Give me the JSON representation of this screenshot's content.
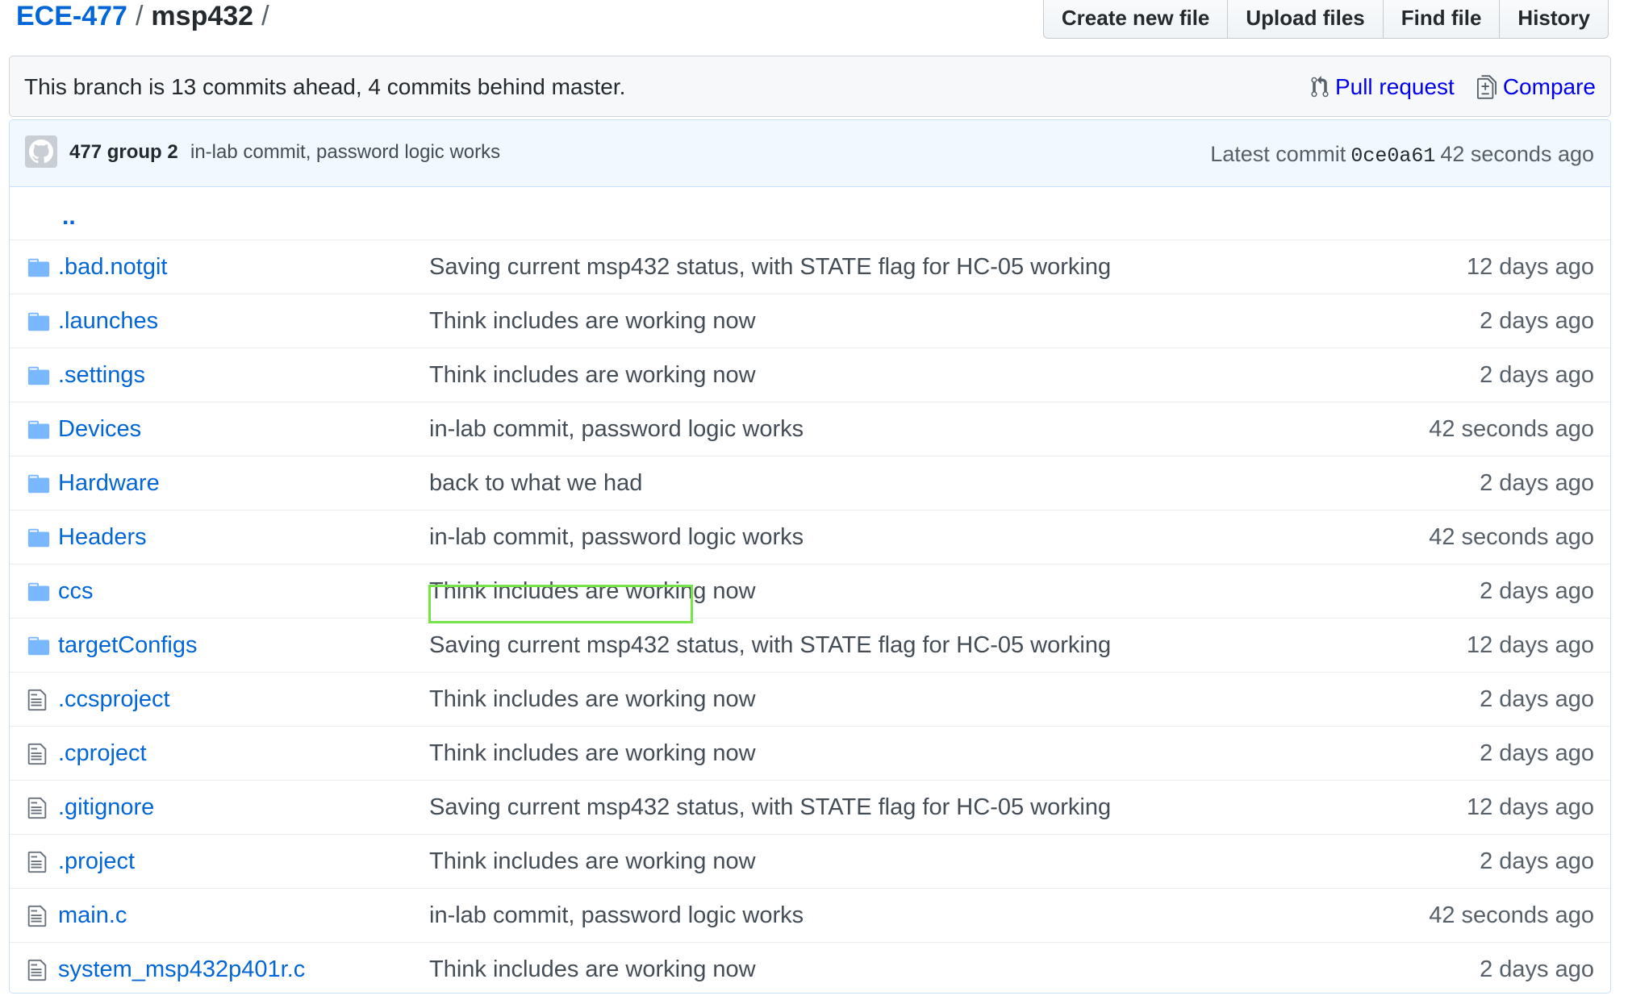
{
  "breadcrumb": {
    "repo": "ECE-477",
    "separator": "/",
    "directory": "msp432",
    "trailing": "/"
  },
  "toolbar": {
    "create_new_file": "Create new file",
    "upload_files": "Upload files",
    "find_file": "Find file",
    "history": "History"
  },
  "branch_info": {
    "message": "This branch is 13 commits ahead, 4 commits behind master.",
    "pull_request": "Pull request",
    "compare": "Compare"
  },
  "latest_commit": {
    "author": "477 group 2",
    "message": "in-lab commit, password logic works",
    "label": "Latest commit",
    "sha": "0ce0a61",
    "age": "42 seconds ago"
  },
  "parent_link": "..",
  "files": [
    {
      "type": "folder",
      "name": ".bad.notgit",
      "message": "Saving current msp432 status, with STATE flag for HC-05 working",
      "age": "12 days ago"
    },
    {
      "type": "folder",
      "name": ".launches",
      "message": "Think includes are working now",
      "age": "2 days ago"
    },
    {
      "type": "folder",
      "name": ".settings",
      "message": "Think includes are working now",
      "age": "2 days ago"
    },
    {
      "type": "folder",
      "name": "Devices",
      "message": "in-lab commit, password logic works",
      "age": "42 seconds ago"
    },
    {
      "type": "folder",
      "name": "Hardware",
      "message": "back to what we had",
      "age": "2 days ago"
    },
    {
      "type": "folder",
      "name": "Headers",
      "message": "in-lab commit, password logic works",
      "age": "42 seconds ago"
    },
    {
      "type": "folder",
      "name": "ccs",
      "message": "Think includes are working now",
      "age": "2 days ago"
    },
    {
      "type": "folder",
      "name": "targetConfigs",
      "message": "Saving current msp432 status, with STATE flag for HC-05 working",
      "age": "12 days ago"
    },
    {
      "type": "file",
      "name": ".ccsproject",
      "message": "Think includes are working now",
      "age": "2 days ago"
    },
    {
      "type": "file",
      "name": ".cproject",
      "message": "Think includes are working now",
      "age": "2 days ago"
    },
    {
      "type": "file",
      "name": ".gitignore",
      "message": "Saving current msp432 status, with STATE flag for HC-05 working",
      "age": "12 days ago"
    },
    {
      "type": "file",
      "name": ".project",
      "message": "Think includes are working now",
      "age": "2 days ago"
    },
    {
      "type": "file",
      "name": "main.c",
      "message": "in-lab commit, password logic works",
      "age": "42 seconds ago"
    },
    {
      "type": "file",
      "name": "system_msp432p401r.c",
      "message": "Think includes are working now",
      "age": "2 days ago"
    }
  ],
  "colors": {
    "link": "#0366d6",
    "folder_icon": "#79b8ff",
    "file_icon": "#6a737d",
    "highlight": "#76e34a"
  },
  "icons": {
    "folder": "folder-icon",
    "file": "file-icon",
    "pull_request": "git-pull-request-icon",
    "compare": "diff-icon",
    "avatar": "octocat-avatar"
  }
}
